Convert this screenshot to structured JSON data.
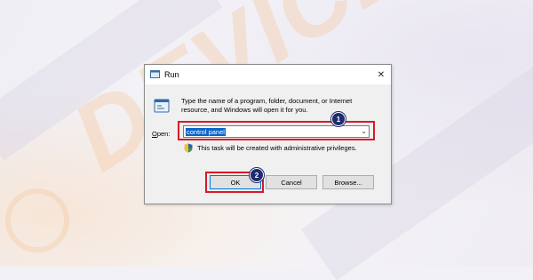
{
  "watermark": "DEVICETRICKS",
  "dialog": {
    "title": "Run",
    "close_glyph": "✕",
    "description": "Type the name of a program, folder, document, or Internet resource, and Windows will open it for you.",
    "open_label_accel": "O",
    "open_label_rest": "pen:",
    "open_value": "control panel",
    "dropdown_glyph": "⌄",
    "admin_note": "This task will be created with administrative privileges.",
    "buttons": {
      "ok": "OK",
      "cancel": "Cancel",
      "browse": "Browse..."
    }
  },
  "annotations": {
    "step1": "1",
    "step2": "2"
  },
  "colors": {
    "highlight": "#d8192a",
    "badge": "#1f2d6e",
    "selection": "#0a64c8"
  }
}
